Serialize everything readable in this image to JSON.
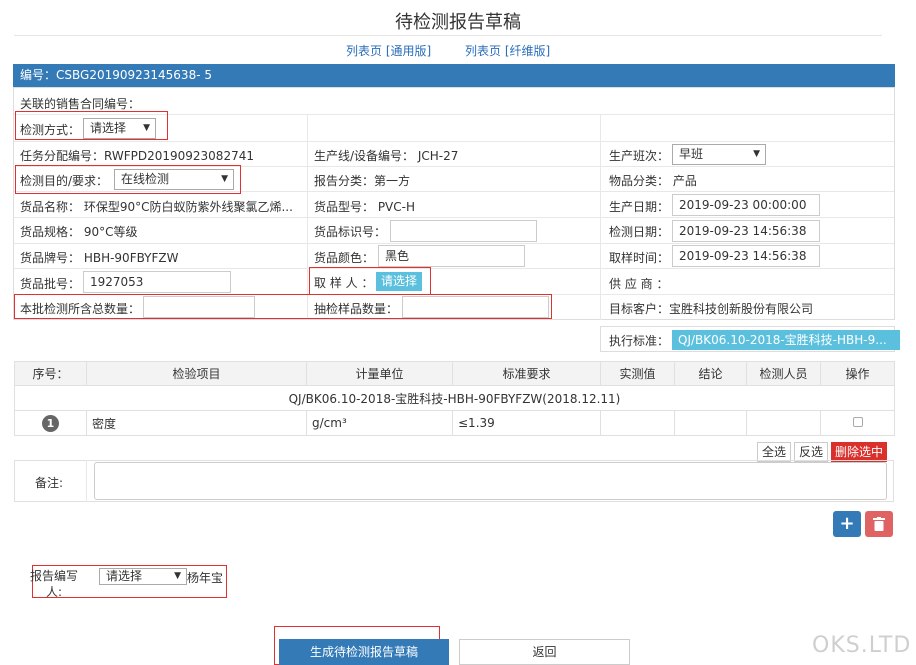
{
  "title": "待检测报告草稿",
  "links": {
    "general": "列表页 [通用版]",
    "fiber": "列表页 [纤维版]"
  },
  "header_bar": "编号：CSBG20190923145638- 5",
  "fields": {
    "contract_label": "关联的销售合同编号：",
    "method_label": "检测方式：",
    "method_value": "请选择",
    "task_no": "任务分配编号：RWFPD20190923082741",
    "line_no": "生产线/设备编号： JCH-27",
    "shift_label": "生产班次：",
    "shift_value": "早班",
    "purpose_label": "检测目的/要求：",
    "purpose_value": "在线检测",
    "report_class": "报告分类：第一方",
    "item_class": "物品分类： 产品",
    "goods_name": "货品名称： 环保型90°C防白蚁防紫外线聚氯乙烯...",
    "goods_model": "货品型号： PVC-H",
    "prod_date_label": "生产日期：",
    "prod_date_value": "2019-09-23 00:00:00",
    "goods_spec": "货品规格： 90°C等级",
    "goods_mark_label": "货品标识号：",
    "goods_mark_value": "",
    "test_date_label": "检测日期：",
    "test_date_value": "2019-09-23 14:56:38",
    "goods_brand": "货品牌号： HBH-90FBYFZW",
    "goods_color_label": "货品颜色：",
    "goods_color_value": "黑色",
    "sample_time_label": "取样时间：",
    "sample_time_value": "2019-09-23 14:56:38",
    "batch_label": "货品批号：",
    "batch_value": "1927053",
    "sampler_label": "取 样 人 ：",
    "sampler_button": "请选择",
    "supplier": "供 应 商 ：",
    "total_qty_label": "本批检测所含总数量：",
    "total_qty_value": "",
    "sample_qty_label": "抽检样品数量：",
    "sample_qty_value": "",
    "target_customer": "目标客户：宝胜科技创新股份有限公司"
  },
  "standard": {
    "label": "执行标准：",
    "value": "QJ/BK06.10-2018-宝胜科技-HBH-9..."
  },
  "table": {
    "headers": [
      "序号：",
      "检验项目",
      "计量单位",
      "标准要求",
      "实测值",
      "结论",
      "检测人员",
      "操作"
    ],
    "group_title": "QJ/BK06.10-2018-宝胜科技-HBH-90FBYFZW(2018.12.11)",
    "rows": [
      {
        "no": "1",
        "item": "密度",
        "unit": "g/cm³",
        "requirement": "≤1.39",
        "measured": "",
        "result": "",
        "inspector": ""
      }
    ]
  },
  "row_actions": {
    "select_all": "全选",
    "invert": "反选",
    "delete_selected": "删除选中"
  },
  "remark_label": "备注:",
  "remark_value": "",
  "report_writer": {
    "label": "报告编写人:",
    "select_value": "请选择",
    "name": "杨年宝"
  },
  "buttons": {
    "generate": "生成待检测报告草稿",
    "back": "返回"
  },
  "watermark": "OKS.LTD",
  "colors": {
    "primary": "#337ab7",
    "info": "#5bc0de",
    "danger": "#d9302c",
    "highlight_border": "#e03030"
  }
}
